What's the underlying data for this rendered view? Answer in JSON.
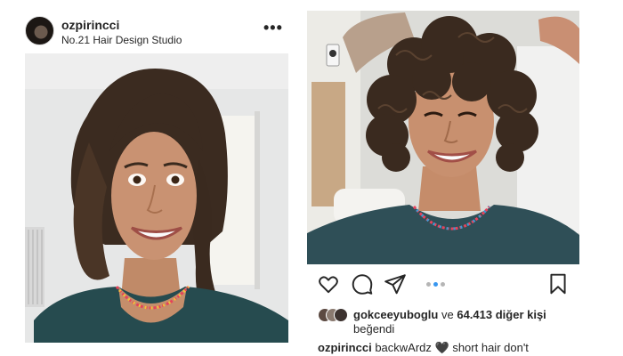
{
  "left_post": {
    "username": "ozpirincci",
    "location": "No.21 Hair Design Studio",
    "more_icon": "more-horizontal-icon",
    "more_glyph": "•••"
  },
  "right_post": {
    "actions": {
      "like_icon": "heart-icon",
      "comment_icon": "comment-icon",
      "share_icon": "share-paper-plane-icon",
      "save_icon": "bookmark-icon"
    },
    "carousel": {
      "count": 3,
      "active_index": 1
    },
    "likes": {
      "first_liker": "gokceeyuboglu",
      "connector": "ve",
      "count_text": "64.413 diğer kişi",
      "line2": "beğendi"
    },
    "caption": {
      "username": "ozpirincci",
      "text_before": "backwArdz",
      "heart": "🖤",
      "text_after": "short hair don't"
    }
  },
  "colors": {
    "text": "#262626",
    "accent_blue": "#3897f0",
    "muted": "#b5b5b5",
    "background": "#ffffff"
  }
}
